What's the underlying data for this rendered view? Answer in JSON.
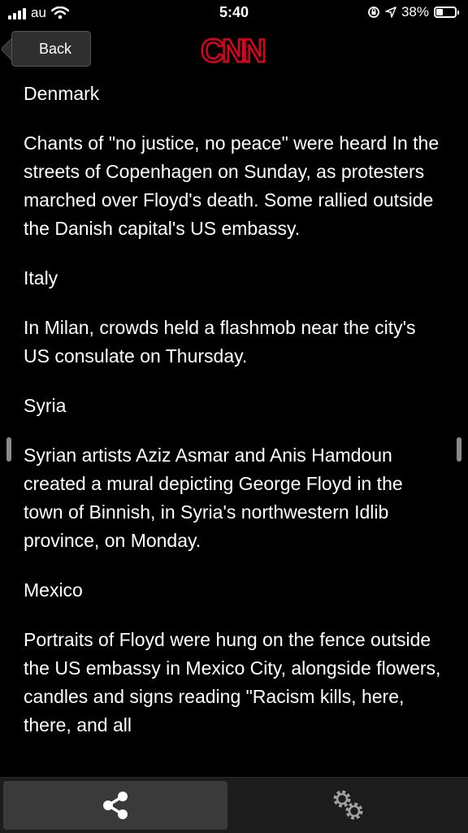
{
  "status": {
    "carrier": "au",
    "time": "5:40",
    "battery": "38%",
    "battery_level": 0.38,
    "icons": [
      "signal-bars-icon",
      "wifi-icon",
      "orientation-lock-icon",
      "location-arrow-icon",
      "battery-icon"
    ]
  },
  "header": {
    "back_label": "Back",
    "logo": "CNN",
    "logo_color": "#e1001e"
  },
  "article": {
    "paragraphs": [
      "Denmark",
      "Chants of \"no justice, no peace\" were heard In the streets of Copenhagen on Sunday, as protesters marched over Floyd's death. Some rallied outside the Danish capital's US embassy.",
      "Italy",
      "In Milan, crowds held a flashmob near the city's US consulate on Thursday.",
      "Syria",
      "Syrian artists Aziz Asmar and Anis Hamdoun created a mural depicting George Floyd in the town of Binnish, in Syria's northwestern Idlib province, on Monday.",
      "Mexico",
      "Portraits of Floyd were hung on the fence outside the US embassy in Mexico City, alongside flowers, candles and signs reading \"Racism kills, here, there, and all"
    ]
  },
  "toolbar": {
    "items": [
      "share-icon",
      "settings-gears-icon"
    ]
  }
}
